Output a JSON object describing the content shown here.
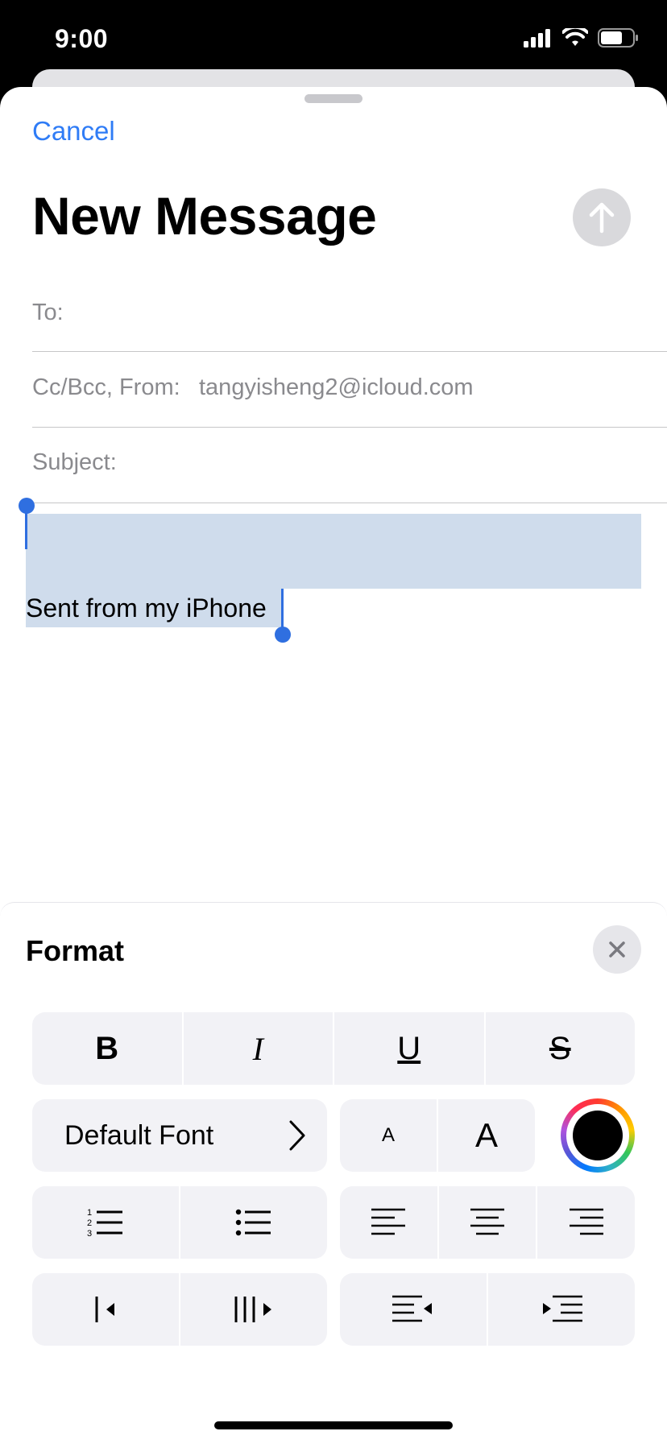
{
  "status_bar": {
    "time": "9:00"
  },
  "compose": {
    "cancel_label": "Cancel",
    "title": "New Message",
    "to_label": "To:",
    "from_label": "Cc/Bcc, From:",
    "from_value": "tangyisheng2@icloud.com",
    "subject_label": "Subject:",
    "body_text": "Sent from my iPhone"
  },
  "format": {
    "title": "Format",
    "style_buttons": [
      "B",
      "I",
      "U",
      "S"
    ],
    "font_label": "Default Font",
    "size_small": "A",
    "size_large": "A",
    "text_color": "#000000",
    "accent": "#2f7cf6"
  }
}
